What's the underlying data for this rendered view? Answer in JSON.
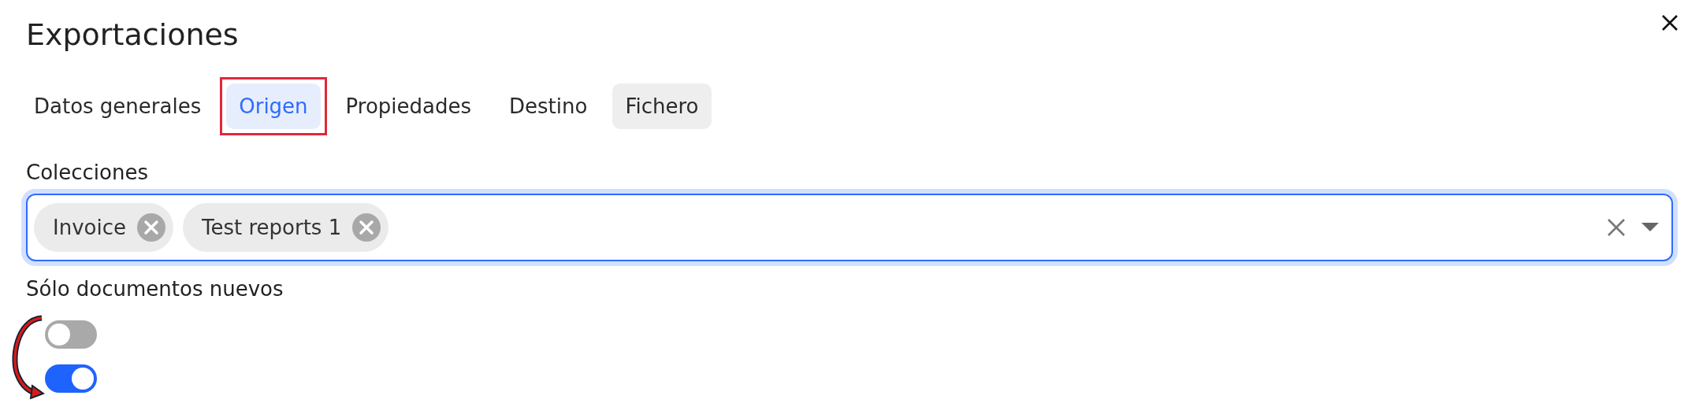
{
  "dialog": {
    "title": "Exportaciones"
  },
  "tabs": [
    {
      "label": "Datos generales",
      "selected": false,
      "hovered": false,
      "highlighted": false
    },
    {
      "label": "Origen",
      "selected": true,
      "hovered": false,
      "highlighted": true
    },
    {
      "label": "Propiedades",
      "selected": false,
      "hovered": false,
      "highlighted": false
    },
    {
      "label": "Destino",
      "selected": false,
      "hovered": false,
      "highlighted": false
    },
    {
      "label": "Fichero",
      "selected": false,
      "hovered": true,
      "highlighted": false
    }
  ],
  "collections": {
    "label": "Colecciones",
    "focused": true,
    "chips": [
      "Invoice",
      "Test reports 1"
    ]
  },
  "only_new": {
    "label": "Sólo documentos nuevos",
    "toggles": [
      {
        "on": false
      },
      {
        "on": true
      }
    ]
  }
}
